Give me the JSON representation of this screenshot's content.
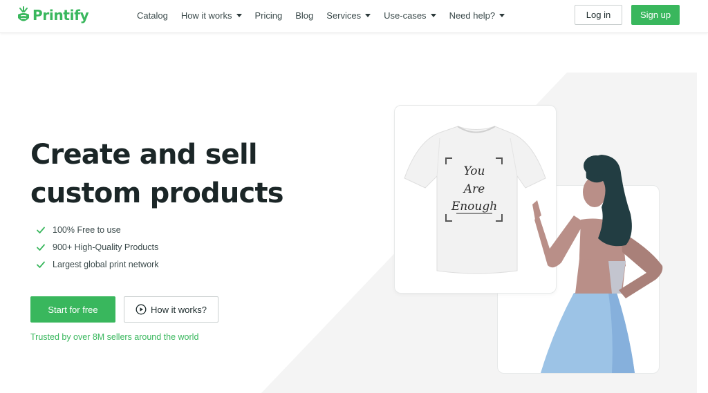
{
  "brand": {
    "name": "Printify",
    "color": "#39b75d"
  },
  "nav": {
    "items": [
      {
        "label": "Catalog",
        "dropdown": false
      },
      {
        "label": "How it works",
        "dropdown": true
      },
      {
        "label": "Pricing",
        "dropdown": false
      },
      {
        "label": "Blog",
        "dropdown": false
      },
      {
        "label": "Services",
        "dropdown": true
      },
      {
        "label": "Use-cases",
        "dropdown": true
      },
      {
        "label": "Need help?",
        "dropdown": true
      }
    ],
    "login_label": "Log in",
    "signup_label": "Sign up"
  },
  "hero": {
    "title_line1": "Create and sell",
    "title_line2": "custom products",
    "features": [
      "100% Free to use",
      "900+ High-Quality Products",
      "Largest global print network"
    ],
    "cta_primary": "Start for free",
    "cta_secondary": "How it works?",
    "trusted": "Trusted by over 8M sellers around the world"
  },
  "tshirt_print": [
    "You",
    "Are",
    "Enough"
  ],
  "icons": {
    "check": "check-icon",
    "play": "play-circle-icon",
    "caret": "chevron-down-icon",
    "logo": "printify-logo-icon"
  },
  "colors": {
    "accent": "#39b75d",
    "text_dark": "#1b2627",
    "bg_shape": "#f4f4f4",
    "skirt": "#9cc3e6",
    "skin": "#b98f88",
    "hair": "#223d42"
  }
}
